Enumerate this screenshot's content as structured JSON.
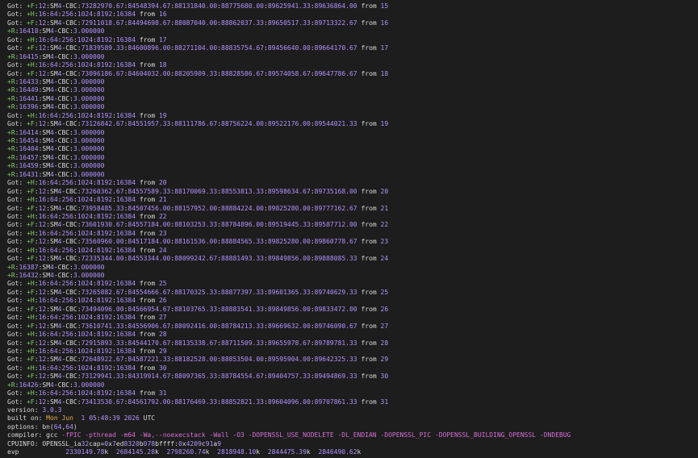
{
  "colors": {
    "background": "#1d1d1d",
    "text": "#d8d8d8",
    "number": "#b293ff",
    "plus_label": "#7fd16a",
    "flag": "#d66fd6",
    "date": "#e5a94a"
  },
  "lines": [
    "Got: +F:12:SM4-CBC:73282970.67:84548394.67:88131840.00:88775680.00:89625941.33:89636864.00 from 15",
    "Got: +H:16:64:256:1024:8192:16384 from 16",
    "Got: +F:12:SM4-CBC:72911018.67:84494698.67:88087040.00:88862037.33:89650517.33:89713322.67 from 16",
    "+R:16418:SM4-CBC:3.000000",
    "Got: +H:16:64:256:1024:8192:16384 from 17",
    "Got: +F:12:SM4-CBC:71839589.33:84600896.00:88271104.00:88835754.67:89456640.00:89664170.67 from 17",
    "+R:16415:SM4-CBC:3.000000",
    "Got: +H:16:64:256:1024:8192:16384 from 18",
    "Got: +F:12:SM4-CBC:73096186.67:84604032.00:88205909.33:88828586.67:89574058.67:89647786.67 from 18",
    "+R:16433:SM4-CBC:3.000000",
    "+R:16449:SM4-CBC:3.000000",
    "+R:16441:SM4-CBC:3.000000",
    "+R:16396:SM4-CBC:3.000000",
    "Got: +H:16:64:256:1024:8192:16384 from 19",
    "Got: +F:12:SM4-CBC:73126842.67:84551957.33:88111786.67:88756224.00:89522176.00:89544021.33 from 19",
    "+R:16414:SM4-CBC:3.000000",
    "+R:16454:SM4-CBC:3.000000",
    "+R:16404:SM4-CBC:3.000000",
    "+R:16457:SM4-CBC:3.000000",
    "+R:16459:SM4-CBC:3.000000",
    "+R:16431:SM4-CBC:3.000000",
    "Got: +H:16:64:256:1024:8192:16384 from 20",
    "Got: +F:12:SM4-CBC:73260362.67:84557589.33:88170069.33:88553813.33:89598634.67:89735168.00 from 20",
    "Got: +H:16:64:256:1024:8192:16384 from 21",
    "Got: +F:12:SM4-CBC:73958485.33:84507456.00:88157952.00:88884224.00:89825280.00:89777162.67 from 21",
    "Got: +H:16:64:256:1024:8192:16384 from 22",
    "Got: +F:12:SM4-CBC:73601930.67:84557184.00:88103253.33:88784896.00:89519445.33:89587712.00 from 22",
    "Got: +H:16:64:256:1024:8192:16384 from 23",
    "Got: +F:12:SM4-CBC:73560960.00:84517184.00:88161536.00:88884565.33:89825280.00:89860778.67 from 23",
    "Got: +H:16:64:256:1024:8192:16384 from 24",
    "Got: +F:12:SM4-CBC:72335344.00:84553344.00:88099242.67:88881493.33:89849856.00:89888085.33 from 24",
    "+R:16387:SM4-CBC:3.000000",
    "+R:16432:SM4-CBC:3.000000",
    "Got: +H:16:64:256:1024:8192:16384 from 25",
    "Got: +F:12:SM4-CBC:73265882.67:84554666.67:88170325.33:88877397.33:89601365.33:89740629.33 from 25",
    "Got: +H:16:64:256:1024:8192:16384 from 26",
    "Got: +F:12:SM4-CBC:73494096.00:84566954.67:88103765.33:88883541.33:89849856.00:89833472.00 from 26",
    "Got: +H:16:64:256:1024:8192:16384 from 27",
    "Got: +F:12:SM4-CBC:73610741.33:84556906.67:88092416.00:88784213.33:89669632.00:89746090.67 from 27",
    "Got: +H:16:64:256:1024:8192:16384 from 28",
    "Got: +F:12:SM4-CBC:72915893.33:84544170.67:88135338.67:88711509.33:89655978.67:89789781.33 from 28",
    "Got: +H:16:64:256:1024:8192:16384 from 29",
    "Got: +F:12:SM4-CBC:72648922.67:84587221.33:88182528.00:88853504.00:89595904.00:89642325.33 from 29",
    "Got: +H:16:64:256:1024:8192:16384 from 30",
    "Got: +F:12:SM4-CBC:73129941.33:84319914.67:88097365.33:88784554.67:89404757.33:89494869.33 from 30",
    "+R:16426:SM4-CBC:3.000000",
    "Got: +H:16:64:256:1024:8192:16384 from 31",
    "Got: +F:12:SM4-CBC:73413530.67:84561792.00:88176469.33:88852821.33:89604096.00:89707861.33 from 31",
    "version: 3.0.3",
    "built on: Mon Jun  1 05:48:39 2026 UTC",
    "options: bn(64,64)",
    "compiler: gcc -fPIC -pthread -m64 -Wa,--noexecstack -Wall -O3 -DOPENSSL_USE_NODELETE -DL_ENDIAN -DOPENSSL_PIC -DOPENSSL_BUILDING_OPENSSL -DNDEBUG",
    "CPUINFO: OPENSSL_ia32cap=0x7ed8320b078bffff:0x4209c91a9",
    "evp            2330149.78k  2684145.28k  2798260.74k  2818948.10k  2844475.39k  2846490.62k"
  ]
}
